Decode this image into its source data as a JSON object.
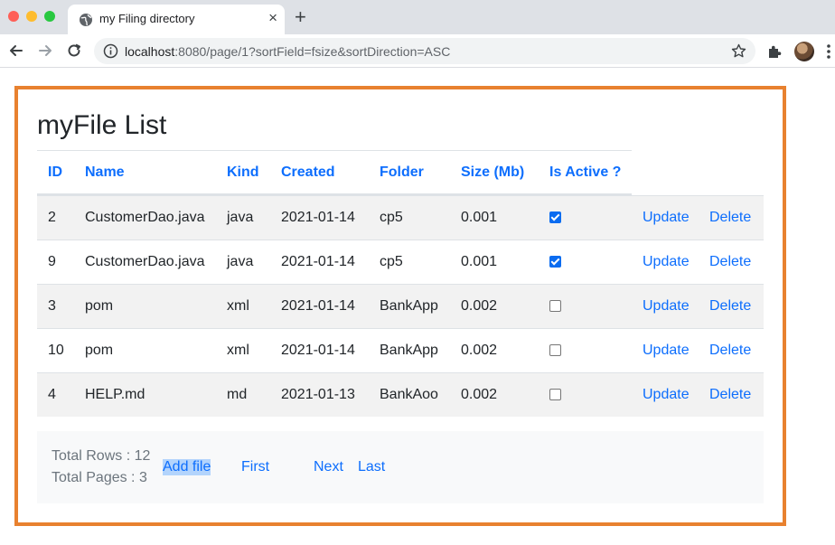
{
  "browser": {
    "tab_title": "my Filing directory",
    "new_tab": "+",
    "tab_close": "×",
    "url_host": "localhost",
    "url_rest": ":8080/page/1?sortField=fsize&sortDirection=ASC"
  },
  "page": {
    "title": "myFile List"
  },
  "table": {
    "headers": [
      "ID",
      "Name",
      "Kind",
      "Created",
      "Folder",
      "Size (Mb)",
      "Is Active ?"
    ],
    "rows": [
      {
        "id": "2",
        "name": "CustomerDao.java",
        "kind": "java",
        "created": "2021-01-14",
        "folder": "cp5",
        "size": "0.001",
        "active": true,
        "update": "Update",
        "delete": "Delete"
      },
      {
        "id": "9",
        "name": "CustomerDao.java",
        "kind": "java",
        "created": "2021-01-14",
        "folder": "cp5",
        "size": "0.001",
        "active": true,
        "update": "Update",
        "delete": "Delete"
      },
      {
        "id": "3",
        "name": "pom",
        "kind": "xml",
        "created": "2021-01-14",
        "folder": "BankApp",
        "size": "0.002",
        "active": false,
        "update": "Update",
        "delete": "Delete"
      },
      {
        "id": "10",
        "name": "pom",
        "kind": "xml",
        "created": "2021-01-14",
        "folder": "BankApp",
        "size": "0.002",
        "active": false,
        "update": "Update",
        "delete": "Delete"
      },
      {
        "id": "4",
        "name": "HELP.md",
        "kind": "md",
        "created": "2021-01-13",
        "folder": "BankAoo",
        "size": "0.002",
        "active": false,
        "update": "Update",
        "delete": "Delete"
      }
    ]
  },
  "footer": {
    "total_rows": "Total Rows : 12",
    "total_pages": "Total Pages : 3",
    "add_file": "Add file",
    "first": "First",
    "next": "Next",
    "last": "Last"
  },
  "colors": {
    "accent": "#0d6efd",
    "frame": "#e8812f",
    "stripe": "#f2f2f2"
  },
  "icons": [
    "globe-icon",
    "back-arrow-icon",
    "forward-arrow-icon",
    "reload-icon",
    "info-icon",
    "star-icon",
    "puzzle-icon",
    "profile-avatar",
    "more-vertical-icon"
  ]
}
